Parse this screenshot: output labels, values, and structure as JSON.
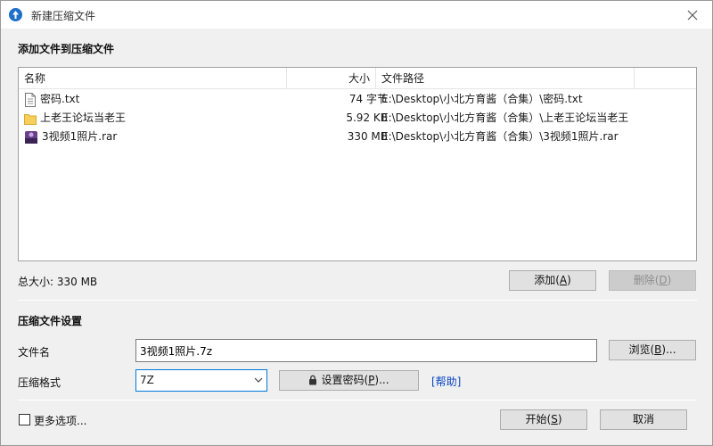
{
  "window": {
    "title": "新建压缩文件",
    "app_icon": "zip-app-icon",
    "close_icon": "close-icon"
  },
  "add_section": {
    "title": "添加文件到压缩文件"
  },
  "file_list": {
    "columns": {
      "name": "名称",
      "size": "大小",
      "path": "文件路径"
    },
    "rows": [
      {
        "icon": "text-file-icon",
        "name": "密码.txt",
        "size": "74 字节",
        "path": "E:\\Desktop\\小北方育酱（合集）\\密码.txt"
      },
      {
        "icon": "folder-icon",
        "name": "上老王论坛当老王",
        "size": "5.92 KB",
        "path": "E:\\Desktop\\小北方育酱（合集）\\上老王论坛当老王"
      },
      {
        "icon": "rar-archive-icon",
        "name": "3视频1照片.rar",
        "size": "330 MB",
        "path": "E:\\Desktop\\小北方育酱（合集）\\3视频1照片.rar"
      }
    ]
  },
  "total_size": "总大小: 330 MB",
  "buttons": {
    "add_text": "添加(",
    "add_key": "A",
    "add_end": ")",
    "delete_text": "删除(",
    "delete_key": "D",
    "delete_end": ")",
    "browse_text": "浏览(",
    "browse_key": "B",
    "browse_end": ")...",
    "set_password_text": "设置密码(",
    "set_password_key": "P",
    "set_password_end": ")...",
    "start_text": "开始(",
    "start_key": "S",
    "start_end": ")",
    "cancel": "取消"
  },
  "settings_section": {
    "title": "压缩文件设置",
    "filename_label": "文件名",
    "filename_value": "3视频1照片.7z",
    "format_label": "压缩格式",
    "format_value": "7Z",
    "help_link": "[帮助]"
  },
  "more_options": "更多选项..."
}
